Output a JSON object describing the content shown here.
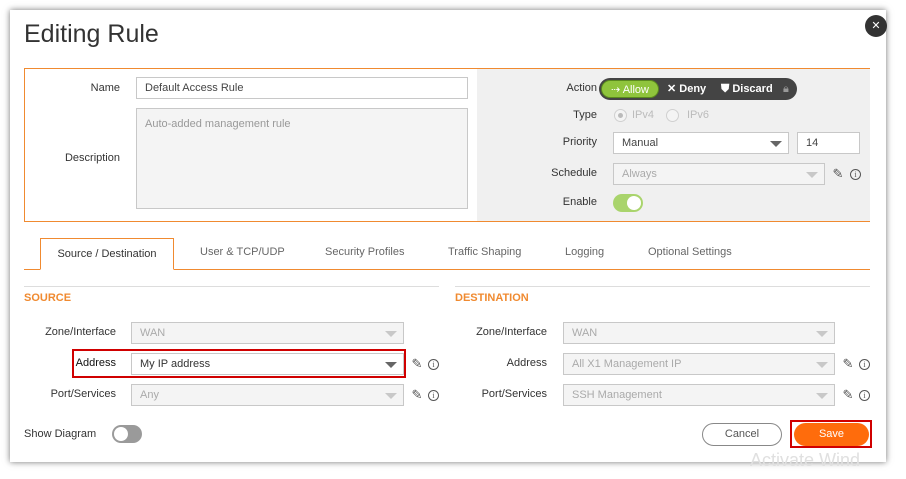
{
  "title": "Editing Rule",
  "general": {
    "name_label": "Name",
    "name_value": "Default Access Rule",
    "description_label": "Description",
    "description_value": "Auto-added management rule",
    "action_label": "Action",
    "action_options": [
      "Allow",
      "Deny",
      "Discard"
    ],
    "action_selected": "Allow",
    "type_label": "Type",
    "type_options": [
      "IPv4",
      "IPv6"
    ],
    "priority_label": "Priority",
    "priority_value": "Manual",
    "priority_number": "14",
    "schedule_label": "Schedule",
    "schedule_value": "Always",
    "enable_label": "Enable",
    "enable_on": true
  },
  "tabs": [
    "Source / Destination",
    "User & TCP/UDP",
    "Security Profiles",
    "Traffic Shaping",
    "Logging",
    "Optional Settings"
  ],
  "source": {
    "title": "SOURCE",
    "zone_label": "Zone/Interface",
    "zone_value": "WAN",
    "address_label": "Address",
    "address_value": "My IP address",
    "port_label": "Port/Services",
    "port_value": "Any"
  },
  "destination": {
    "title": "DESTINATION",
    "zone_label": "Zone/Interface",
    "zone_value": "WAN",
    "address_label": "Address",
    "address_value": "All X1 Management IP",
    "port_label": "Port/Services",
    "port_value": "SSH Management"
  },
  "footer": {
    "show_diagram_label": "Show Diagram",
    "cancel_label": "Cancel",
    "save_label": "Save"
  },
  "watermark": "Activate Wind",
  "colors": {
    "accent": "#f08a30",
    "allow": "#8fc43c",
    "save": "#ff6c0c",
    "highlight": "#d00000"
  },
  "icons": [
    "close-icon",
    "lock-icon",
    "pencil-icon",
    "info-icon",
    "chevron-down-icon"
  ]
}
